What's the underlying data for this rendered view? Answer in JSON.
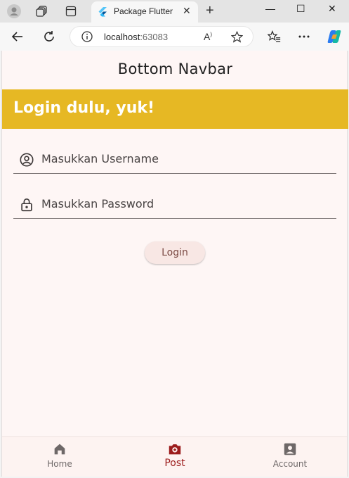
{
  "browser": {
    "tab_title": "Package Flutter",
    "tab_close": "✕",
    "new_tab": "+",
    "url_host": "localhost",
    "url_port": ":63083",
    "window_controls": [
      "—",
      "☐",
      "✕"
    ]
  },
  "app": {
    "appbar_title": "Bottom Navbar",
    "banner_title": "Login dulu, yuk!",
    "username_placeholder": "Masukkan Username",
    "password_placeholder": "Masukkan Password",
    "login_label": "Login",
    "accent_color": "#e6b824",
    "active_color": "#9c1c1c"
  },
  "bottom_nav": {
    "items": [
      {
        "label": "Home",
        "icon": "home-icon",
        "active": false
      },
      {
        "label": "Post",
        "icon": "camera-post-icon",
        "active": true
      },
      {
        "label": "Account",
        "icon": "account-box-icon",
        "active": false
      }
    ]
  }
}
